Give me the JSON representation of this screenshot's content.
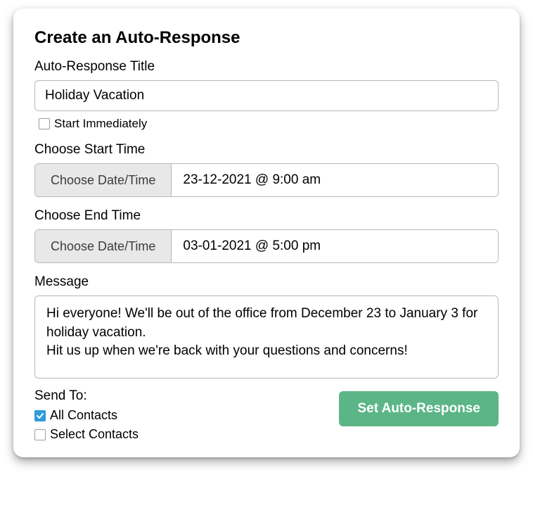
{
  "title": "Create an Auto-Response",
  "fields": {
    "title_label": "Auto-Response Title",
    "title_value": "Holiday Vacation",
    "start_immediately_label": "Start Immediately",
    "start_immediately_checked": false,
    "start_label": "Choose Start Time",
    "end_label": "Choose End Time",
    "choose_dt_label": "Choose Date/Time",
    "start_value": "23-12-2021 @ 9:00 am",
    "end_value": "03-01-2021 @ 5:00 pm",
    "message_label": "Message",
    "message_value": "Hi everyone! We'll be out of the office from December 23 to January 3 for holiday vacation.\nHit us up when we're back with your questions and concerns!",
    "send_to_label": "Send To:",
    "send_all_label": "All Contacts",
    "send_all_checked": true,
    "send_select_label": "Select Contacts",
    "send_select_checked": false
  },
  "submit_label": "Set Auto-Response"
}
